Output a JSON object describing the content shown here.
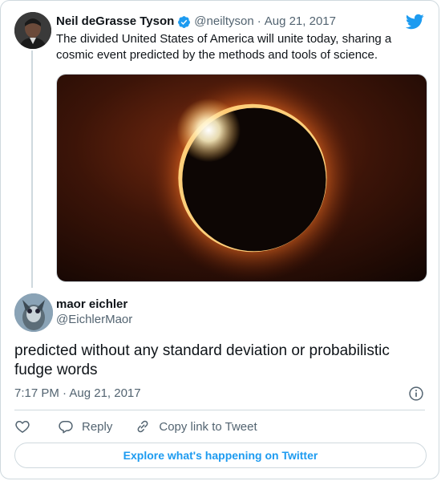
{
  "parent_tweet": {
    "author_name": "Neil deGrasse Tyson",
    "handle": "@neiltyson",
    "separator": "·",
    "date": "Aug 21, 2017",
    "text": "The divided United States of America will unite today, sharing a cosmic event predicted by the methods and tools of science.",
    "verified": true,
    "media_icon": "solar-eclipse-photo"
  },
  "reply_tweet": {
    "author_name": "maor eichler",
    "handle": "@EichlerMaor",
    "text": "predicted without any standard deviation or probabilistic fudge words",
    "timestamp": "7:17 PM · Aug 21, 2017"
  },
  "actions": {
    "like_icon": "heart-icon",
    "reply_label": "Reply",
    "copy_link_label": "Copy link to Tweet"
  },
  "footer": {
    "explore_label": "Explore what's happening on Twitter"
  },
  "colors": {
    "accent": "#1d9bf0",
    "text_primary": "#0f1419",
    "text_secondary": "#536471",
    "border": "#cfd9de"
  }
}
